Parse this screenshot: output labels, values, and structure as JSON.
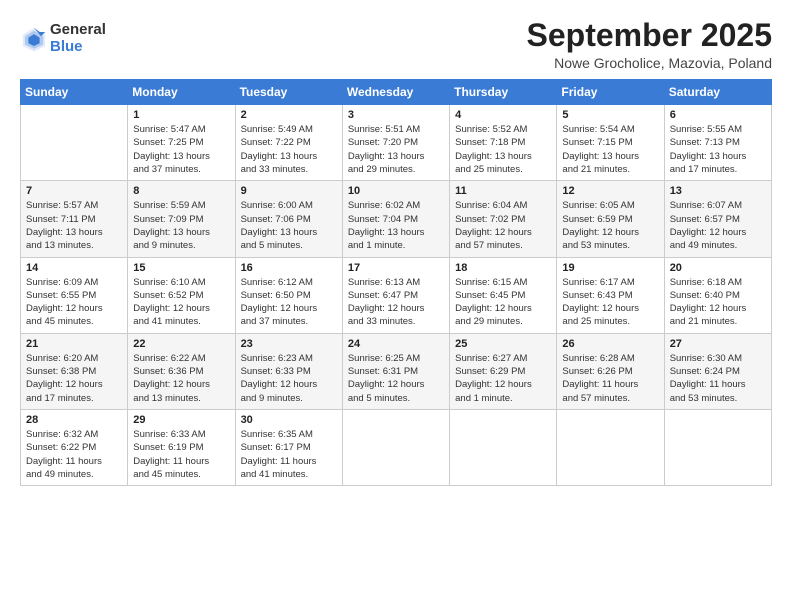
{
  "logo": {
    "general": "General",
    "blue": "Blue"
  },
  "title": "September 2025",
  "location": "Nowe Grocholice, Mazovia, Poland",
  "days_header": [
    "Sunday",
    "Monday",
    "Tuesday",
    "Wednesday",
    "Thursday",
    "Friday",
    "Saturday"
  ],
  "weeks": [
    [
      {
        "day": "",
        "info": ""
      },
      {
        "day": "1",
        "info": "Sunrise: 5:47 AM\nSunset: 7:25 PM\nDaylight: 13 hours\nand 37 minutes."
      },
      {
        "day": "2",
        "info": "Sunrise: 5:49 AM\nSunset: 7:22 PM\nDaylight: 13 hours\nand 33 minutes."
      },
      {
        "day": "3",
        "info": "Sunrise: 5:51 AM\nSunset: 7:20 PM\nDaylight: 13 hours\nand 29 minutes."
      },
      {
        "day": "4",
        "info": "Sunrise: 5:52 AM\nSunset: 7:18 PM\nDaylight: 13 hours\nand 25 minutes."
      },
      {
        "day": "5",
        "info": "Sunrise: 5:54 AM\nSunset: 7:15 PM\nDaylight: 13 hours\nand 21 minutes."
      },
      {
        "day": "6",
        "info": "Sunrise: 5:55 AM\nSunset: 7:13 PM\nDaylight: 13 hours\nand 17 minutes."
      }
    ],
    [
      {
        "day": "7",
        "info": "Sunrise: 5:57 AM\nSunset: 7:11 PM\nDaylight: 13 hours\nand 13 minutes."
      },
      {
        "day": "8",
        "info": "Sunrise: 5:59 AM\nSunset: 7:09 PM\nDaylight: 13 hours\nand 9 minutes."
      },
      {
        "day": "9",
        "info": "Sunrise: 6:00 AM\nSunset: 7:06 PM\nDaylight: 13 hours\nand 5 minutes."
      },
      {
        "day": "10",
        "info": "Sunrise: 6:02 AM\nSunset: 7:04 PM\nDaylight: 13 hours\nand 1 minute."
      },
      {
        "day": "11",
        "info": "Sunrise: 6:04 AM\nSunset: 7:02 PM\nDaylight: 12 hours\nand 57 minutes."
      },
      {
        "day": "12",
        "info": "Sunrise: 6:05 AM\nSunset: 6:59 PM\nDaylight: 12 hours\nand 53 minutes."
      },
      {
        "day": "13",
        "info": "Sunrise: 6:07 AM\nSunset: 6:57 PM\nDaylight: 12 hours\nand 49 minutes."
      }
    ],
    [
      {
        "day": "14",
        "info": "Sunrise: 6:09 AM\nSunset: 6:55 PM\nDaylight: 12 hours\nand 45 minutes."
      },
      {
        "day": "15",
        "info": "Sunrise: 6:10 AM\nSunset: 6:52 PM\nDaylight: 12 hours\nand 41 minutes."
      },
      {
        "day": "16",
        "info": "Sunrise: 6:12 AM\nSunset: 6:50 PM\nDaylight: 12 hours\nand 37 minutes."
      },
      {
        "day": "17",
        "info": "Sunrise: 6:13 AM\nSunset: 6:47 PM\nDaylight: 12 hours\nand 33 minutes."
      },
      {
        "day": "18",
        "info": "Sunrise: 6:15 AM\nSunset: 6:45 PM\nDaylight: 12 hours\nand 29 minutes."
      },
      {
        "day": "19",
        "info": "Sunrise: 6:17 AM\nSunset: 6:43 PM\nDaylight: 12 hours\nand 25 minutes."
      },
      {
        "day": "20",
        "info": "Sunrise: 6:18 AM\nSunset: 6:40 PM\nDaylight: 12 hours\nand 21 minutes."
      }
    ],
    [
      {
        "day": "21",
        "info": "Sunrise: 6:20 AM\nSunset: 6:38 PM\nDaylight: 12 hours\nand 17 minutes."
      },
      {
        "day": "22",
        "info": "Sunrise: 6:22 AM\nSunset: 6:36 PM\nDaylight: 12 hours\nand 13 minutes."
      },
      {
        "day": "23",
        "info": "Sunrise: 6:23 AM\nSunset: 6:33 PM\nDaylight: 12 hours\nand 9 minutes."
      },
      {
        "day": "24",
        "info": "Sunrise: 6:25 AM\nSunset: 6:31 PM\nDaylight: 12 hours\nand 5 minutes."
      },
      {
        "day": "25",
        "info": "Sunrise: 6:27 AM\nSunset: 6:29 PM\nDaylight: 12 hours\nand 1 minute."
      },
      {
        "day": "26",
        "info": "Sunrise: 6:28 AM\nSunset: 6:26 PM\nDaylight: 11 hours\nand 57 minutes."
      },
      {
        "day": "27",
        "info": "Sunrise: 6:30 AM\nSunset: 6:24 PM\nDaylight: 11 hours\nand 53 minutes."
      }
    ],
    [
      {
        "day": "28",
        "info": "Sunrise: 6:32 AM\nSunset: 6:22 PM\nDaylight: 11 hours\nand 49 minutes."
      },
      {
        "day": "29",
        "info": "Sunrise: 6:33 AM\nSunset: 6:19 PM\nDaylight: 11 hours\nand 45 minutes."
      },
      {
        "day": "30",
        "info": "Sunrise: 6:35 AM\nSunset: 6:17 PM\nDaylight: 11 hours\nand 41 minutes."
      },
      {
        "day": "",
        "info": ""
      },
      {
        "day": "",
        "info": ""
      },
      {
        "day": "",
        "info": ""
      },
      {
        "day": "",
        "info": ""
      }
    ]
  ]
}
